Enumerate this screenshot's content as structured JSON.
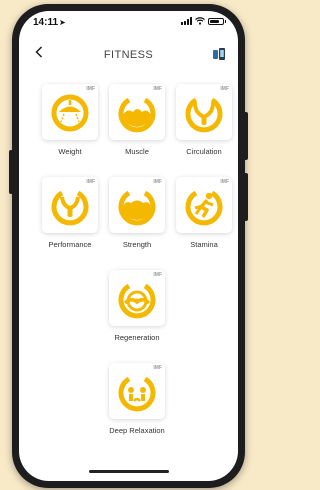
{
  "status": {
    "time": "14:11"
  },
  "header": {
    "title": "FITNESS"
  },
  "brand": {
    "accent": "#f5b800"
  },
  "tiles": [
    {
      "label": "Weight",
      "badge": "IMF",
      "icon": "scale-icon"
    },
    {
      "label": "Muscle",
      "badge": "IMF",
      "icon": "muscle-icon"
    },
    {
      "label": "Circulation",
      "badge": "IMF",
      "icon": "circulation-icon"
    },
    {
      "label": "Performance",
      "badge": "IMF",
      "icon": "performance-icon"
    },
    {
      "label": "Strength",
      "badge": "IMF",
      "icon": "strength-icon"
    },
    {
      "label": "Stamina",
      "badge": "IMF",
      "icon": "runner-icon"
    },
    {
      "label": "Regeneration",
      "badge": "IMF",
      "icon": "regeneration-icon"
    },
    {
      "label": "Deep Relaxation",
      "badge": "IMF",
      "icon": "relaxation-icon"
    }
  ]
}
